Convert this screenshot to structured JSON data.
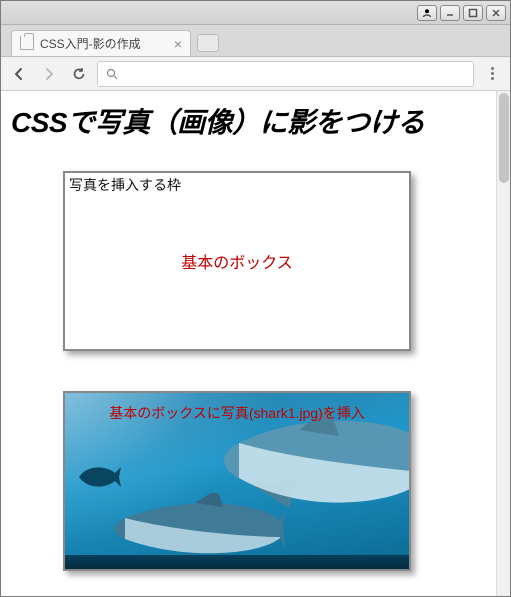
{
  "window": {
    "sys_buttons": [
      "user",
      "minimize",
      "maximize",
      "close"
    ]
  },
  "browser": {
    "tab": {
      "title": "CSS入門-影の作成"
    },
    "omnibox": {
      "value": "",
      "placeholder": ""
    }
  },
  "page": {
    "heading": "CSSで写真（画像）に影をつける",
    "box1_caption": "写真を挿入する枠",
    "box1_center": "基本のボックス",
    "box2_label": "基本のボックスに写真(shark1.jpg)を挿入"
  }
}
